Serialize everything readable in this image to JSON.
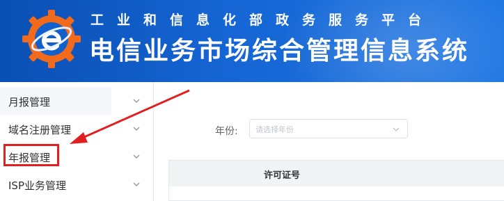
{
  "header": {
    "subtitle": "工业和信息化部政务服务平台",
    "title": "电信业务市场综合管理信息系统"
  },
  "sidebar": {
    "items": [
      {
        "label": "月报管理"
      },
      {
        "label": "域名注册管理"
      },
      {
        "label": "年报管理"
      },
      {
        "label": "ISP业务管理"
      }
    ]
  },
  "filter": {
    "year_label": "年份:",
    "year_placeholder": "请选择年份"
  },
  "table": {
    "columns": [
      "许可证号"
    ]
  },
  "colors": {
    "header_blue": "#1565d4",
    "highlight_red": "#e02020",
    "logo_orange": "#f26b1d"
  }
}
